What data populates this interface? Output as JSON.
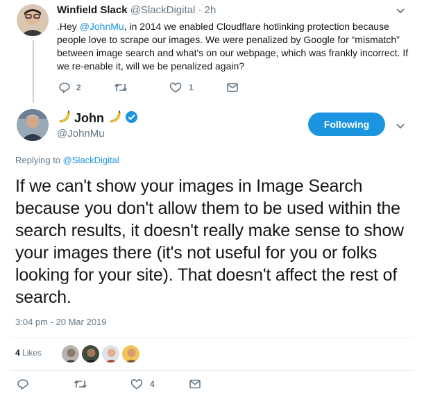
{
  "retweet": {
    "name": "Winfield Slack",
    "handle": "@SlackDigital",
    "separator": "·",
    "time": "2h",
    "text_before": ".Hey ",
    "mention": "@JohnMu",
    "text_after": ", in 2014 we enabled Cloudflare hotlinking protection because people love to scrape our images. We were penalized by Google for “mismatch” between image search and what's on our webpage, which was frankly incorrect. If we re-enable it, will we be penalized again?",
    "replies": "2",
    "likes": "1"
  },
  "main_tweet": {
    "name": "John",
    "handle": "@JohnMu",
    "follow_label": "Following",
    "replying_prefix": "Replying to ",
    "replying_to": "@SlackDigital",
    "text": "If we can't show your images in Image Search because you don't allow them to be used within the search results, it doesn't really make sense to show your images there (it's not useful for you or folks looking for your site). That doesn't affect the rest of search.",
    "timestamp": "3:04 pm - 20 Mar 2019",
    "like_count": "4",
    "like_label": "Likes",
    "footer_likes": "4"
  },
  "icons": {
    "reply": "reply-icon",
    "retweet": "retweet-icon",
    "like": "heart-icon",
    "dm": "mail-icon",
    "caret": "chevron-down-icon",
    "verified": "verified-badge-icon",
    "banana": "banana-emoji"
  },
  "colors": {
    "accent": "#1b95e0",
    "muted": "#657786",
    "text": "#14171a",
    "thread_line": "#c4cfd6"
  }
}
